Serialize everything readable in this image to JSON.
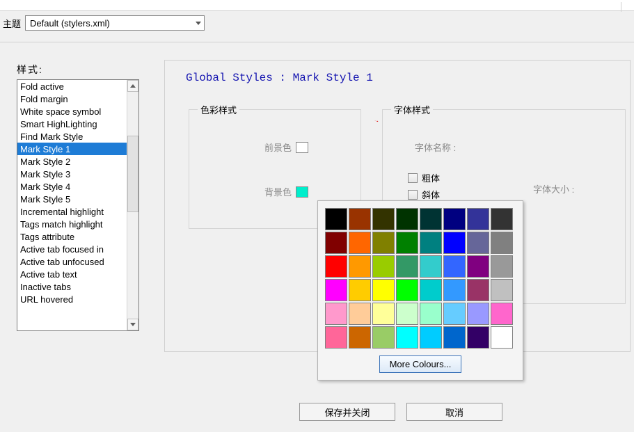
{
  "theme": {
    "label": "主题",
    "selected": "Default (stylers.xml)"
  },
  "style_list": {
    "label": "样式:",
    "items": [
      "Fold active",
      "Fold margin",
      "White space symbol",
      "Smart HighLighting",
      "Find Mark Style",
      "Mark Style 1",
      "Mark Style 2",
      "Mark Style 3",
      "Mark Style 4",
      "Mark Style 5",
      "Incremental highlight",
      "Tags match highlight",
      "Tags attribute",
      "Active tab focused in",
      "Active tab unfocused",
      "Active tab text",
      "Inactive tabs",
      "URL hovered"
    ],
    "selected_index": 5
  },
  "main": {
    "title": "Global Styles : Mark Style 1",
    "color_group": "色彩样式",
    "font_group": "字体样式",
    "foreground_label": "前景色",
    "background_label": "背景色",
    "foreground_value": "#ffffff",
    "background_value": "#00eecc",
    "font_name_label": "字体名称 :",
    "bold_label": "粗体",
    "italic_label": "斜体",
    "font_size_label": "字体大小 :"
  },
  "color_picker": {
    "more_label": "More Colours...",
    "grid": [
      "#000000",
      "#993300",
      "#333300",
      "#003300",
      "#003333",
      "#000080",
      "#333399",
      "#333333",
      "#800000",
      "#ff6600",
      "#808000",
      "#008000",
      "#008080",
      "#0000ff",
      "#666699",
      "#808080",
      "#ff0000",
      "#ff9900",
      "#99cc00",
      "#339966",
      "#33cccc",
      "#3366ff",
      "#800080",
      "#999999",
      "#ff00ff",
      "#ffcc00",
      "#ffff00",
      "#00ff00",
      "#00cccc",
      "#3399ff",
      "#993366",
      "#c0c0c0",
      "#ff99cc",
      "#ffcc99",
      "#ffff99",
      "#ccffcc",
      "#99ffcc",
      "#66ccff",
      "#9999ff",
      "#ff66cc",
      "#ff6699",
      "#cc6600",
      "#99cc66",
      "#00ffff",
      "#00ccff",
      "#0066cc",
      "#330066",
      "#ffffff"
    ]
  },
  "buttons": {
    "save_close": "保存并关闭",
    "cancel": "取消"
  }
}
